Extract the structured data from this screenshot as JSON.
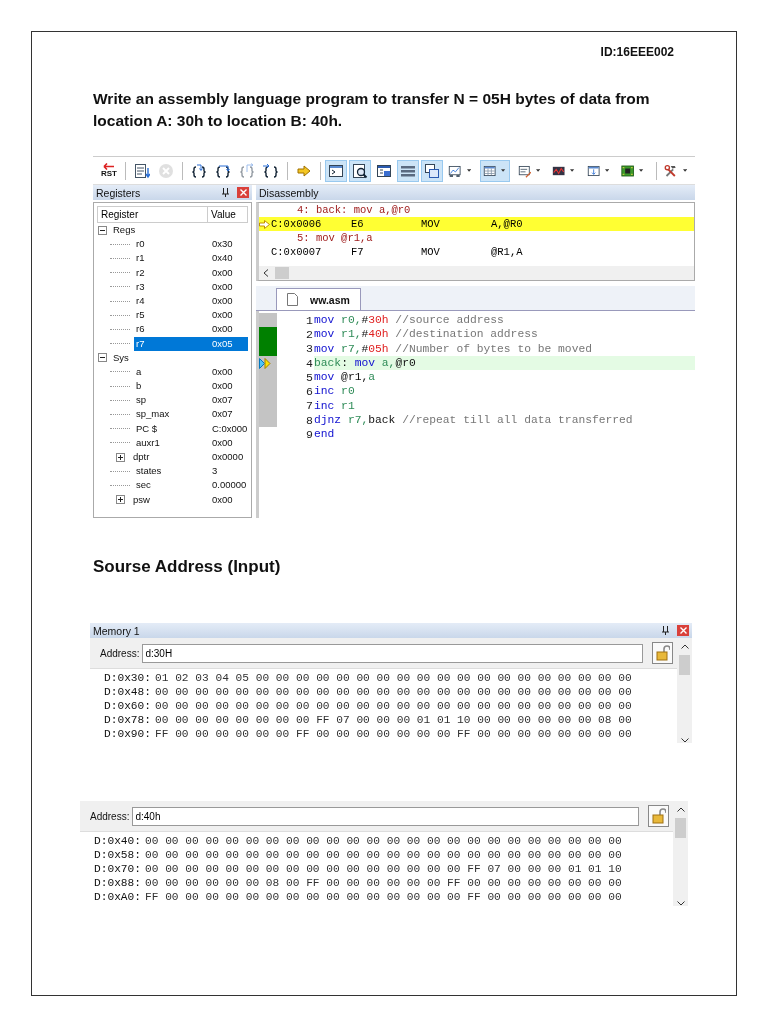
{
  "document_id": "ID:16EEE002",
  "question": "Write an assembly language program to transfer N = 05H bytes of data from location A: 30h to location B: 40h.",
  "debugger": {
    "toolbar": [
      {
        "kind": "reset",
        "label": "RST",
        "pressed": false,
        "dropdown": false,
        "disabled": false
      },
      {
        "kind": "separator"
      },
      {
        "kind": "run",
        "pressed": false,
        "dropdown": false,
        "disabled": false
      },
      {
        "kind": "stop",
        "pressed": false,
        "dropdown": false,
        "disabled": true
      },
      {
        "kind": "separator"
      },
      {
        "kind": "step-into",
        "pressed": false,
        "dropdown": false,
        "disabled": false
      },
      {
        "kind": "step-over",
        "pressed": false,
        "dropdown": false,
        "disabled": false
      },
      {
        "kind": "step-out",
        "pressed": false,
        "dropdown": false,
        "disabled": true
      },
      {
        "kind": "run-to-cursor",
        "pressed": false,
        "dropdown": false,
        "disabled": false
      },
      {
        "kind": "separator"
      },
      {
        "kind": "next-statement",
        "pressed": false,
        "dropdown": false,
        "disabled": false
      },
      {
        "kind": "separator"
      },
      {
        "kind": "command-window",
        "pressed": true,
        "dropdown": false,
        "disabled": false
      },
      {
        "kind": "disassembly-window",
        "pressed": true,
        "dropdown": false,
        "disabled": false
      },
      {
        "kind": "symbols-window",
        "pressed": false,
        "dropdown": false,
        "disabled": false
      },
      {
        "kind": "registers-window",
        "pressed": true,
        "dropdown": false,
        "disabled": false
      },
      {
        "kind": "call-stack-window",
        "pressed": true,
        "dropdown": false,
        "disabled": false
      },
      {
        "kind": "watch-window",
        "pressed": false,
        "dropdown": true,
        "disabled": false
      },
      {
        "kind": "memory-window",
        "pressed": true,
        "dropdown": true,
        "disabled": false
      },
      {
        "kind": "serial-window",
        "pressed": false,
        "dropdown": true,
        "disabled": false
      },
      {
        "kind": "analysis-window",
        "pressed": false,
        "dropdown": true,
        "disabled": false
      },
      {
        "kind": "trace-window",
        "pressed": false,
        "dropdown": true,
        "disabled": false
      },
      {
        "kind": "system-viewer",
        "pressed": false,
        "dropdown": true,
        "disabled": false
      },
      {
        "kind": "separator"
      },
      {
        "kind": "tools",
        "pressed": false,
        "dropdown": true,
        "disabled": false
      }
    ],
    "registers": {
      "title": "Registers",
      "columns": [
        "Register",
        "Value"
      ],
      "tree": [
        {
          "name": "Regs",
          "expanded": true,
          "selected": false,
          "children": [
            {
              "name": "r0",
              "value": "0x30",
              "selected": false
            },
            {
              "name": "r1",
              "value": "0x40",
              "selected": false
            },
            {
              "name": "r2",
              "value": "0x00",
              "selected": false
            },
            {
              "name": "r3",
              "value": "0x00",
              "selected": false
            },
            {
              "name": "r4",
              "value": "0x00",
              "selected": false
            },
            {
              "name": "r5",
              "value": "0x00",
              "selected": false
            },
            {
              "name": "r6",
              "value": "0x00",
              "selected": false
            },
            {
              "name": "r7",
              "value": "0x05",
              "selected": true
            }
          ]
        },
        {
          "name": "Sys",
          "expanded": true,
          "selected": false,
          "children": [
            {
              "name": "a",
              "value": "0x00",
              "selected": false
            },
            {
              "name": "b",
              "value": "0x00",
              "selected": false
            },
            {
              "name": "sp",
              "value": "0x07",
              "selected": false
            },
            {
              "name": "sp_max",
              "value": "0x07",
              "selected": false
            },
            {
              "name": "PC  $",
              "value": "C:0x000",
              "selected": false
            },
            {
              "name": "auxr1",
              "value": "0x00",
              "selected": false
            },
            {
              "name": "dptr",
              "value": "0x0000",
              "selected": false,
              "expanded": false
            },
            {
              "name": "states",
              "value": "3",
              "selected": false
            },
            {
              "name": "sec",
              "value": "0.00000",
              "selected": false
            },
            {
              "name": "psw",
              "value": "0x00",
              "selected": false,
              "expanded": false
            }
          ]
        }
      ]
    },
    "disassembly": {
      "title": "Disassembly",
      "lines": [
        {
          "kind": "source",
          "text": "4: back: mov a,@r0"
        },
        {
          "kind": "instruction",
          "current": true,
          "address": "C:0x0006",
          "opcode": "E6",
          "mnemonic": "MOV",
          "operands": "A,@R0"
        },
        {
          "kind": "source",
          "text": "5: mov @r1,a"
        },
        {
          "kind": "instruction",
          "current": false,
          "address": "C:0x0007",
          "opcode": "F7",
          "mnemonic": "MOV",
          "operands": "@R1,A"
        }
      ]
    },
    "editor": {
      "tab": {
        "label": "ww.asm",
        "selected": true
      },
      "lines": [
        {
          "number": "1",
          "kind": "executable",
          "current": false,
          "tokens": [
            {
              "kind": "keyword",
              "text": "mov"
            },
            {
              "kind": "register",
              "text": " r0,"
            },
            {
              "kind": "plain",
              "text": "#"
            },
            {
              "kind": "number",
              "text": "30h"
            },
            {
              "kind": "comment",
              "text": " //source address"
            }
          ]
        },
        {
          "number": "2",
          "kind": "executed",
          "current": false,
          "tokens": [
            {
              "kind": "keyword",
              "text": "mov"
            },
            {
              "kind": "register",
              "text": " r1,"
            },
            {
              "kind": "plain",
              "text": "#"
            },
            {
              "kind": "number",
              "text": "40h"
            },
            {
              "kind": "comment",
              "text": " //destination address"
            }
          ]
        },
        {
          "number": "3",
          "kind": "executed",
          "current": false,
          "tokens": [
            {
              "kind": "keyword",
              "text": "mov"
            },
            {
              "kind": "register",
              "text": " r7,"
            },
            {
              "kind": "plain",
              "text": "#"
            },
            {
              "kind": "number",
              "text": "05h"
            },
            {
              "kind": "comment",
              "text": " //Number of bytes to be moved"
            }
          ]
        },
        {
          "number": "4",
          "kind": "executable",
          "current": true,
          "tokens": [
            {
              "kind": "register",
              "text": "back"
            },
            {
              "kind": "plain",
              "text": ": "
            },
            {
              "kind": "keyword",
              "text": "mov"
            },
            {
              "kind": "register",
              "text": " a,"
            },
            {
              "kind": "plain",
              "text": "@r0"
            }
          ]
        },
        {
          "number": "5",
          "kind": "executable",
          "current": false,
          "tokens": [
            {
              "kind": "keyword",
              "text": "mov"
            },
            {
              "kind": "plain",
              "text": " @r1,"
            },
            {
              "kind": "register",
              "text": "a"
            }
          ]
        },
        {
          "number": "6",
          "kind": "executable",
          "current": false,
          "tokens": [
            {
              "kind": "keyword",
              "text": "inc"
            },
            {
              "kind": "register",
              "text": " r0"
            }
          ]
        },
        {
          "number": "7",
          "kind": "executable",
          "current": false,
          "tokens": [
            {
              "kind": "keyword",
              "text": "inc"
            },
            {
              "kind": "register",
              "text": " r1"
            }
          ]
        },
        {
          "number": "8",
          "kind": "executable",
          "current": false,
          "tokens": [
            {
              "kind": "keyword",
              "text": "djnz"
            },
            {
              "kind": "register",
              "text": " r7,"
            },
            {
              "kind": "plain",
              "text": "back"
            },
            {
              "kind": "comment",
              "text": " //repeat till all data transferred"
            }
          ]
        },
        {
          "number": "9",
          "kind": "plain",
          "current": false,
          "tokens": [
            {
              "kind": "keyword",
              "text": "end"
            }
          ]
        }
      ]
    }
  },
  "section_heading": "Sourse Address (Input)",
  "memory_input": {
    "title": "Memory 1",
    "address_label": "Address:",
    "address": "d:30H",
    "rows": [
      {
        "address": "D:0x30:",
        "bytes": "01 02 03 04 05 00 00 00 00 00 00 00 00 00 00 00 00 00 00 00 00 00 00 00"
      },
      {
        "address": "D:0x48:",
        "bytes": "00 00 00 00 00 00 00 00 00 00 00 00 00 00 00 00 00 00 00 00 00 00 00 00"
      },
      {
        "address": "D:0x60:",
        "bytes": "00 00 00 00 00 00 00 00 00 00 00 00 00 00 00 00 00 00 00 00 00 00 00 00"
      },
      {
        "address": "D:0x78:",
        "bytes": "00 00 00 00 00 00 00 00 FF 07 00 00 00 01 01 10 00 00 00 00 00 00 08 00"
      },
      {
        "address": "D:0x90:",
        "bytes": "FF 00 00 00 00 00 00 FF 00 00 00 00 00 00 00 FF 00 00 00 00 00 00 00 00"
      }
    ]
  },
  "memory_output": {
    "address_label": "Address:",
    "address": "d:40h",
    "rows": [
      {
        "address": "D:0x40:",
        "bytes": "00 00 00 00 00 00 00 00 00 00 00 00 00 00 00 00 00 00 00 00 00 00 00 00"
      },
      {
        "address": "D:0x58:",
        "bytes": "00 00 00 00 00 00 00 00 00 00 00 00 00 00 00 00 00 00 00 00 00 00 00 00"
      },
      {
        "address": "D:0x70:",
        "bytes": "00 00 00 00 00 00 00 00 00 00 00 00 00 00 00 00 FF 07 00 00 00 01 01 10"
      },
      {
        "address": "D:0x88:",
        "bytes": "00 00 00 00 00 00 08 00 FF 00 00 00 00 00 00 FF 00 00 00 00 00 00 00 00"
      },
      {
        "address": "D:0xA0:",
        "bytes": "FF 00 00 00 00 00 00 00 00 00 00 00 00 00 00 00 FF 00 00 00 00 00 00 00"
      }
    ]
  }
}
